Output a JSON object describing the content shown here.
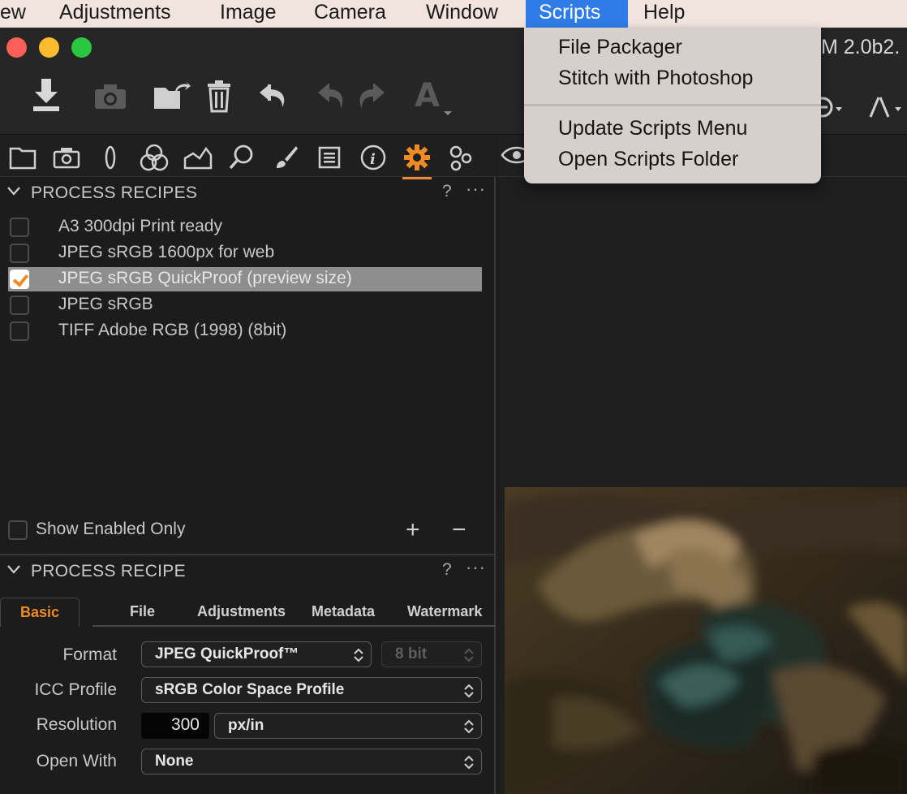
{
  "menubar": {
    "items": [
      "ew",
      "Adjustments",
      "Image",
      "Camera",
      "Window",
      "Scripts",
      "Help"
    ],
    "active": "Scripts"
  },
  "window": {
    "title": "M 2.0b2.",
    "toolbar_icons": [
      "import-icon",
      "camera-icon",
      "move-to-folder-icon",
      "trash-icon",
      "reset-icon",
      "undo-icon",
      "redo-icon",
      "text-annotation-icon",
      "zoom-icon",
      "cursor-tool-icon"
    ]
  },
  "tool_tabs": [
    "library-icon",
    "capture-icon",
    "lens-icon",
    "color-icon",
    "exposure-icon",
    "details-icon",
    "local-adjustments-icon",
    "metadata-icon",
    "info-icon",
    "output-icon",
    "batch-icon"
  ],
  "scripts_menu": {
    "items": [
      "File Packager",
      "Stitch with Photoshop",
      "Update Scripts Menu",
      "Open Scripts Folder"
    ]
  },
  "process_recipes": {
    "title": "PROCESS RECIPES",
    "help": "?",
    "more": "···",
    "items": [
      {
        "label": "A3 300dpi Print ready",
        "checked": false
      },
      {
        "label": "JPEG sRGB 1600px for web",
        "checked": false
      },
      {
        "label": "JPEG sRGB QuickProof (preview size)",
        "checked": true
      },
      {
        "label": "JPEG sRGB",
        "checked": false
      },
      {
        "label": "TIFF Adobe RGB (1998) (8bit)",
        "checked": false
      }
    ],
    "show_enabled_only": "Show Enabled Only",
    "add": "+",
    "remove": "−"
  },
  "process_recipe": {
    "title": "PROCESS RECIPE",
    "help": "?",
    "more": "···",
    "tabs": [
      "Basic",
      "File",
      "Adjustments",
      "Metadata",
      "Watermark"
    ],
    "active_tab": "Basic",
    "fields": {
      "format_label": "Format",
      "format_value": "JPEG QuickProof™",
      "bit_depth": "8 bit",
      "icc_label": "ICC Profile",
      "icc_value": "sRGB Color Space Profile",
      "resolution_label": "Resolution",
      "resolution_value": "300",
      "resolution_unit": "px/in",
      "open_with_label": "Open With",
      "open_with_value": "None"
    }
  },
  "colors": {
    "accent": "#f08a24",
    "menu_highlight": "#2f7ce8",
    "panel_bg": "#1c1c1c"
  }
}
